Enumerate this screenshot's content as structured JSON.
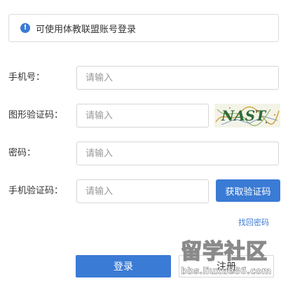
{
  "notice": {
    "icon": "info-icon",
    "icon_glyph": "!",
    "text": "可使用体教联盟账号登录",
    "accent": "#3a7bd5"
  },
  "form": {
    "phone": {
      "label": "手机号：",
      "placeholder": "请输入",
      "value": ""
    },
    "captcha": {
      "label": "图形验证码：",
      "placeholder": "请输入",
      "value": ""
    },
    "password": {
      "label": "密码：",
      "placeholder": "请输入",
      "value": ""
    },
    "sms_code": {
      "label": "手机验证码：",
      "placeholder": "请输入",
      "value": ""
    }
  },
  "captcha_image": {
    "text": "NAST"
  },
  "buttons": {
    "get_code": "获取验证码",
    "forgot_password": "找回密码",
    "login": "登录",
    "register": "注册"
  },
  "watermark": {
    "title": "留学社区",
    "url": "bbs.liuxue86.com"
  }
}
